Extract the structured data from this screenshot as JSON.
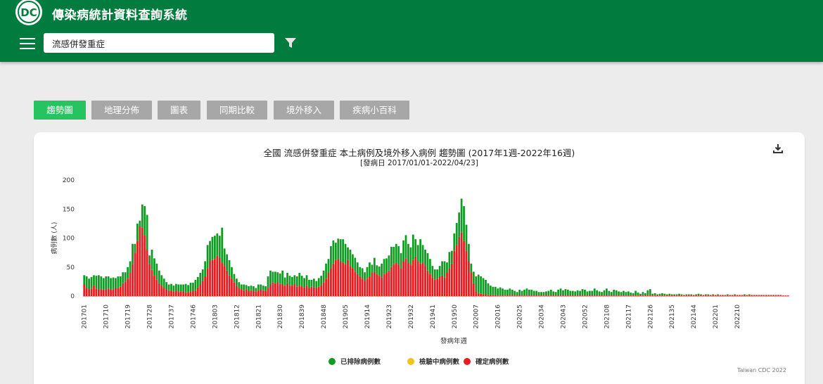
{
  "header": {
    "app_title": "傳染病統計資料查詢系統",
    "search_value": "流感併發重症",
    "colors": {
      "bar": "#027c3e",
      "text": "#ffffff"
    },
    "icons": {
      "logo": "cdc-logo-icon",
      "menu": "hamburger-menu-icon",
      "filter": "filter-icon"
    }
  },
  "tabs": [
    {
      "label": "趨勢圖",
      "active": true
    },
    {
      "label": "地理分佈",
      "active": false
    },
    {
      "label": "圖表",
      "active": false
    },
    {
      "label": "同期比較",
      "active": false
    },
    {
      "label": "境外移入",
      "active": false
    },
    {
      "label": "疾病小百科",
      "active": false
    }
  ],
  "chart_card": {
    "download_icon": "download-icon",
    "credit": "Taiwan CDC 2022"
  },
  "chart_data": {
    "type": "bar",
    "stacked": true,
    "title": "全國 流感併發重症 本土病例及境外移入病例 趨勢圖 (2017年1週-2022年16週)",
    "subtitle": "[發病日 2017/01/01-2022/04/23]",
    "xlabel": "發病年週",
    "ylabel": "病例數 (人)",
    "ylim": [
      0,
      200
    ],
    "yticks": [
      0,
      50,
      100,
      150,
      200
    ],
    "xticks": [
      "201701",
      "201710",
      "201719",
      "201728",
      "201737",
      "201746",
      "201803",
      "201812",
      "201821",
      "201830",
      "201839",
      "201848",
      "201905",
      "201914",
      "201923",
      "201932",
      "201941",
      "201950",
      "202007",
      "202016",
      "202025",
      "202034",
      "202043",
      "202052",
      "202108",
      "202117",
      "202126",
      "202135",
      "202144",
      "202201",
      "202210"
    ],
    "legend": [
      {
        "name": "已排除病例數",
        "color": "#0f9b22"
      },
      {
        "name": "檢驗中病例數",
        "color": "#f0c419"
      },
      {
        "name": "確定病例數",
        "color": "#e8191f"
      }
    ],
    "legend_position": "bottom",
    "grid": false,
    "series": [
      {
        "name": "確定病例數",
        "color": "#e8191f",
        "values": [
          20,
          14,
          12,
          13,
          18,
          13,
          12,
          12,
          11,
          12,
          13,
          11,
          12,
          14,
          14,
          16,
          22,
          25,
          30,
          40,
          55,
          75,
          95,
          120,
          118,
          105,
          80,
          55,
          45,
          35,
          28,
          22,
          18,
          14,
          12,
          10,
          9,
          8,
          9,
          8,
          8,
          8,
          7,
          7,
          8,
          9,
          10,
          15,
          20,
          26,
          34,
          48,
          60,
          62,
          64,
          70,
          66,
          58,
          52,
          44,
          36,
          30,
          24,
          18,
          14,
          12,
          10,
          11,
          9,
          10,
          9,
          8,
          10,
          12,
          10,
          9,
          14,
          20,
          24,
          22,
          23,
          21,
          20,
          18,
          22,
          19,
          18,
          20,
          16,
          18,
          17,
          15,
          18,
          14,
          16,
          15,
          14,
          16,
          19,
          24,
          30,
          40,
          48,
          56,
          62,
          64,
          60,
          58,
          55,
          62,
          52,
          48,
          42,
          38,
          34,
          30,
          26,
          30,
          34,
          40,
          42,
          38,
          35,
          32,
          38,
          40,
          44,
          50,
          55,
          58,
          54,
          48,
          60,
          65,
          58,
          54,
          62,
          68,
          60,
          56,
          58,
          52,
          44,
          38,
          32,
          28,
          30,
          34,
          36,
          32,
          40,
          48,
          56,
          78,
          88,
          102,
          110,
          95,
          78,
          60,
          40,
          22,
          8,
          5,
          4,
          3,
          3,
          2,
          2,
          2,
          2,
          1,
          1,
          1,
          1,
          1,
          1,
          1,
          1,
          1,
          1,
          1,
          1,
          1,
          1,
          1,
          1,
          1,
          1,
          1,
          1,
          1,
          1,
          1,
          1,
          1,
          1,
          1,
          1,
          1,
          1,
          1,
          1,
          1,
          1,
          1,
          1,
          1,
          1,
          1,
          1,
          1,
          1,
          1,
          1,
          1,
          1,
          1,
          1,
          1,
          1,
          1,
          1,
          1,
          1,
          1,
          1,
          1,
          1,
          1,
          1,
          1,
          1,
          1,
          1,
          1,
          1,
          1,
          1,
          1,
          1,
          1,
          1,
          1,
          1,
          1,
          1,
          1,
          1,
          1,
          1,
          1,
          1,
          1,
          1,
          1,
          1,
          1,
          1,
          1,
          1,
          1,
          1,
          1,
          1,
          1,
          1,
          1,
          1,
          1,
          1,
          1,
          1,
          1,
          1,
          1,
          1,
          1,
          1,
          1,
          1,
          1,
          1,
          1,
          1,
          1,
          1,
          1,
          1,
          1,
          1,
          1
        ]
      },
      {
        "name": "檢驗中病例數",
        "color": "#f0c419",
        "values": []
      },
      {
        "name": "已排除病例數",
        "color": "#0f9b22",
        "values": [
          16,
          20,
          18,
          20,
          18,
          22,
          24,
          22,
          20,
          22,
          21,
          20,
          20,
          17,
          20,
          18,
          19,
          16,
          20,
          20,
          35,
          15,
          30,
          10,
          40,
          50,
          60,
          15,
          35,
          30,
          28,
          22,
          18,
          16,
          12,
          10,
          12,
          10,
          12,
          12,
          12,
          12,
          14,
          12,
          15,
          14,
          18,
          18,
          20,
          20,
          26,
          40,
          35,
          40,
          40,
          38,
          38,
          60,
          30,
          28,
          26,
          20,
          14,
          12,
          10,
          8,
          10,
          8,
          8,
          8,
          8,
          6,
          10,
          8,
          8,
          8,
          20,
          24,
          18,
          20,
          18,
          18,
          24,
          14,
          18,
          16,
          15,
          16,
          18,
          22,
          18,
          16,
          18,
          14,
          12,
          15,
          12,
          15,
          16,
          20,
          26,
          24,
          38,
          40,
          30,
          35,
          38,
          40,
          35,
          22,
          28,
          24,
          24,
          20,
          16,
          18,
          15,
          20,
          24,
          14,
          24,
          15,
          16,
          24,
          26,
          25,
          26,
          35,
          30,
          32,
          32,
          26,
          36,
          40,
          32,
          30,
          44,
          30,
          28,
          42,
          30,
          28,
          30,
          26,
          20,
          18,
          16,
          18,
          24,
          28,
          18,
          28,
          22,
          30,
          38,
          42,
          58,
          60,
          45,
          30,
          16,
          20,
          26,
          32,
          30,
          28,
          25,
          20,
          16,
          14,
          14,
          12,
          14,
          12,
          10,
          10,
          12,
          10,
          8,
          6,
          10,
          8,
          10,
          12,
          10,
          10,
          8,
          8,
          6,
          6,
          6,
          7,
          8,
          10,
          7,
          6,
          10,
          12,
          9,
          11,
          10,
          8,
          8,
          7,
          9,
          8,
          11,
          10,
          7,
          8,
          8,
          12,
          9,
          7,
          6,
          9,
          12,
          8,
          6,
          10,
          9,
          7,
          6,
          8,
          6,
          7,
          5,
          4,
          8,
          5,
          3,
          6,
          4,
          9,
          11,
          3,
          4,
          2,
          3,
          4,
          3,
          2,
          3,
          2,
          2,
          2,
          3,
          2,
          1,
          2,
          2,
          2,
          1,
          2,
          3,
          2,
          1,
          2,
          2,
          1,
          2,
          1,
          2,
          1,
          1,
          1,
          2,
          1,
          1,
          2,
          1,
          1,
          1,
          2,
          1,
          2,
          1,
          1,
          1,
          1,
          1,
          1,
          1,
          1,
          1,
          1,
          1,
          1,
          1
        ]
      }
    ]
  }
}
